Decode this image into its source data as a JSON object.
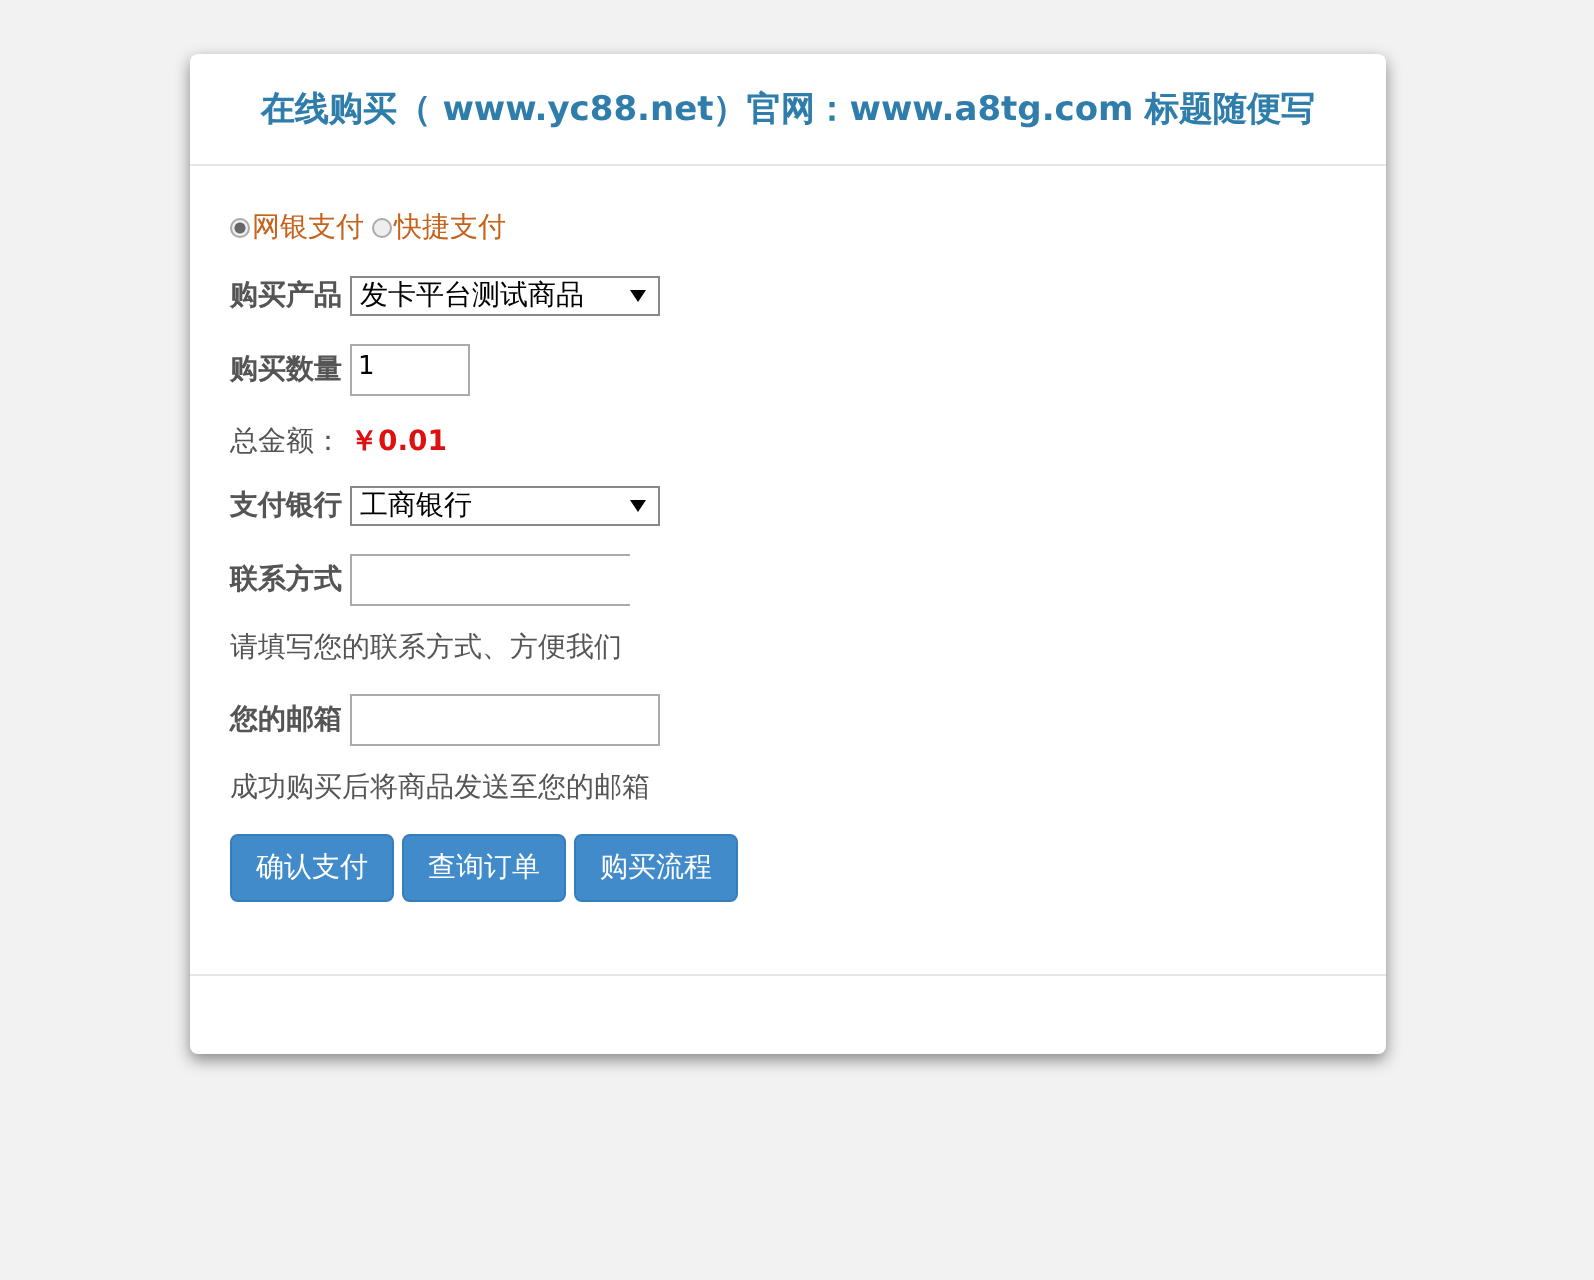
{
  "title": "在线购买（ www.yc88.net）官网：www.a8tg.com 标题随便写",
  "payment_options": [
    {
      "label": "网银支付",
      "selected": true
    },
    {
      "label": "快捷支付",
      "selected": false
    }
  ],
  "rows": [
    {
      "kind": "select",
      "label": "购买产品",
      "value": "发卡平台测试商品"
    },
    {
      "kind": "input",
      "label": "购买数量",
      "value": "1"
    },
    {
      "kind": "total",
      "label": "总金额：",
      "value": "￥0.01"
    },
    {
      "kind": "select",
      "label": "支付银行",
      "value": "工商银行"
    },
    {
      "kind": "input-cut",
      "label": "联系方式",
      "value": ""
    },
    {
      "kind": "hint",
      "label": "请填写您的联系方式、方便我们"
    },
    {
      "kind": "input",
      "label": "您的邮箱",
      "value": ""
    },
    {
      "kind": "hint",
      "label": "成功购买后将商品发送至您的邮箱"
    }
  ],
  "buttons": [
    "确认支付",
    "查询订单",
    "购买流程"
  ]
}
